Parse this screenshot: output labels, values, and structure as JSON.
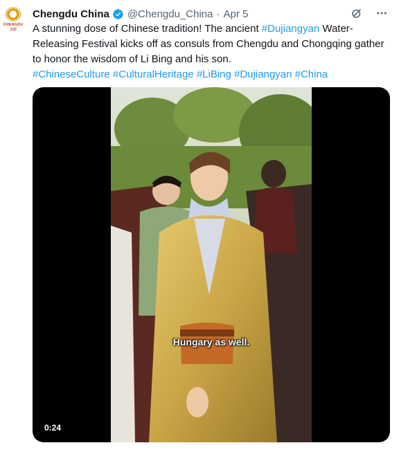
{
  "tweet": {
    "avatar": {
      "icon": "chengdu-logo-icon",
      "logo_text": "CHENGDU",
      "logo_sub": "成都"
    },
    "author": {
      "name": "Chengdu China",
      "handle": "@Chengdu_China",
      "separator": "·",
      "date": "Apr 5",
      "verified_icon": "verified-badge-icon"
    },
    "actions": {
      "grok_icon": "grok-icon",
      "more_icon": "more-options-icon"
    },
    "text": {
      "part1": "A stunning dose of Chinese tradition! The ancient ",
      "tag1": "#Dujiangyan",
      "part2": " Water-Releasing Festival kicks off as consuls from Chengdu and Chongqing gather to honor the wisdom of Li Bing and his son.",
      "hashtags": [
        "#ChineseCulture",
        "#CulturalHeritage",
        "#LiBing",
        "#Dujiangyan",
        "#China"
      ]
    },
    "video": {
      "caption": "Hungary as well.",
      "duration": "0:24"
    }
  },
  "colors": {
    "link": "#1d9bf0",
    "verified": "#1d9bf0",
    "text": "#0f1419",
    "muted": "#536471"
  }
}
